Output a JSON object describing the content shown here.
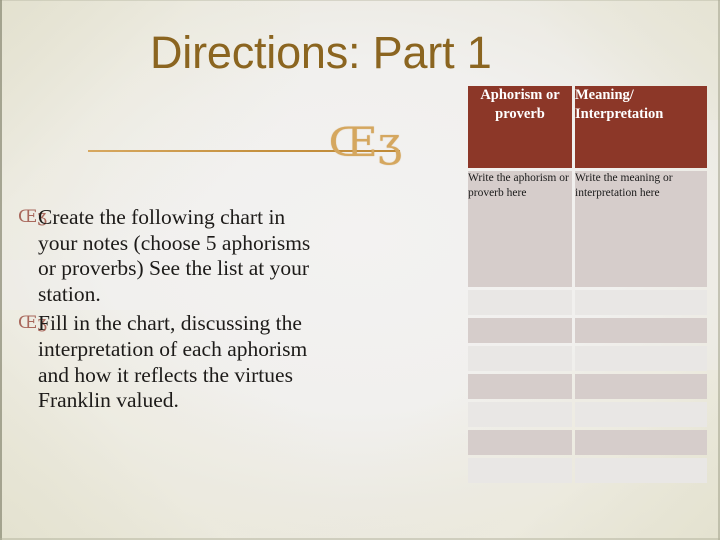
{
  "slide": {
    "title": "Directions: Part 1",
    "ornament_glyph": "Œʒ",
    "bullet_glyph": "Œʒ",
    "colors": {
      "title": "#8b6520",
      "ornament": "#d5a75f",
      "bullet_mark": "#a9685c",
      "table_header_bg": "#8c3728",
      "table_header_text": "#ffffff",
      "row_shade_dark": "#d6cdcb",
      "row_shade_light": "#e9e7e5",
      "background_cream": "#e4e2d1"
    }
  },
  "bullets": [
    {
      "marker": "Œʒ",
      "text": "Create the following chart in your notes (choose 5 aphorisms or proverbs) See the list at your station."
    },
    {
      "marker": "Œʒ",
      "text": "Fill in the chart, discussing the interpretation of each aphorism and how it reflects the virtues Franklin valued."
    }
  ],
  "table": {
    "headers": [
      "Aphorism or proverb",
      "Meaning/ Interpretation"
    ],
    "rows": [
      {
        "shade": "dark",
        "tall": true,
        "cells": [
          "Write the aphorism  or proverb here",
          "Write the meaning or interpretation here"
        ]
      },
      {
        "shade": "light",
        "tall": false,
        "cells": [
          "",
          ""
        ]
      },
      {
        "shade": "dark",
        "tall": false,
        "cells": [
          "",
          ""
        ]
      },
      {
        "shade": "light",
        "tall": false,
        "cells": [
          "",
          ""
        ]
      },
      {
        "shade": "dark",
        "tall": false,
        "cells": [
          "",
          ""
        ]
      },
      {
        "shade": "light",
        "tall": false,
        "cells": [
          "",
          ""
        ]
      },
      {
        "shade": "dark",
        "tall": false,
        "cells": [
          "",
          ""
        ]
      },
      {
        "shade": "light",
        "tall": false,
        "cells": [
          "",
          ""
        ]
      }
    ]
  }
}
